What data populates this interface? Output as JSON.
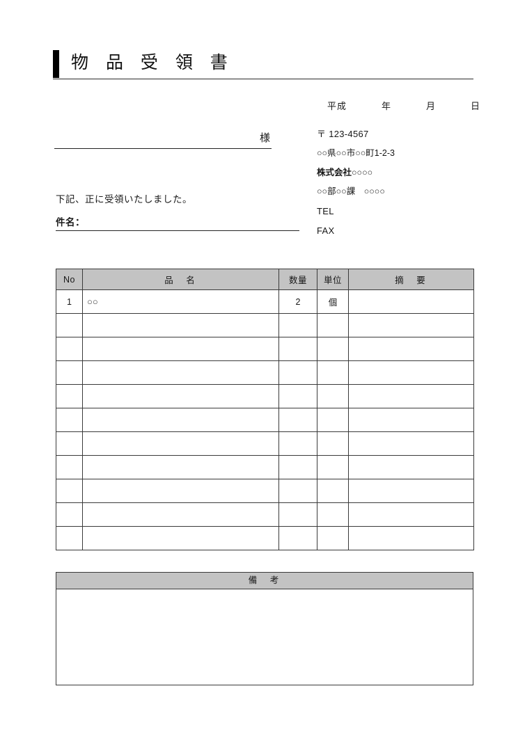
{
  "document": {
    "title": "物 品 受 領 書"
  },
  "date_line": {
    "era": "平成",
    "year": "年",
    "month": "月",
    "day": "日"
  },
  "sender": {
    "postal_code": "〒 123-4567",
    "address": "○○県○○市○○町1-2-3",
    "company": "株式会社○○○○",
    "department": "○○部○○課　○○○○",
    "tel_label": "TEL",
    "fax_label": "FAX"
  },
  "addressee": {
    "honorific": "様"
  },
  "body": {
    "received_note": "下記、正に受領いたしました。",
    "subject_label": "件名："
  },
  "items_table": {
    "headers": {
      "no": "No",
      "name": "品　名",
      "quantity": "数量",
      "unit": "単位",
      "note": "摘　要"
    },
    "rows": [
      {
        "no": "1",
        "name": "○○",
        "quantity": "2",
        "unit": "個",
        "note": ""
      },
      {
        "no": "",
        "name": "",
        "quantity": "",
        "unit": "",
        "note": ""
      },
      {
        "no": "",
        "name": "",
        "quantity": "",
        "unit": "",
        "note": ""
      },
      {
        "no": "",
        "name": "",
        "quantity": "",
        "unit": "",
        "note": ""
      },
      {
        "no": "",
        "name": "",
        "quantity": "",
        "unit": "",
        "note": ""
      },
      {
        "no": "",
        "name": "",
        "quantity": "",
        "unit": "",
        "note": ""
      },
      {
        "no": "",
        "name": "",
        "quantity": "",
        "unit": "",
        "note": ""
      },
      {
        "no": "",
        "name": "",
        "quantity": "",
        "unit": "",
        "note": ""
      },
      {
        "no": "",
        "name": "",
        "quantity": "",
        "unit": "",
        "note": ""
      },
      {
        "no": "",
        "name": "",
        "quantity": "",
        "unit": "",
        "note": ""
      },
      {
        "no": "",
        "name": "",
        "quantity": "",
        "unit": "",
        "note": ""
      }
    ]
  },
  "remarks": {
    "header": "備　考",
    "content": ""
  },
  "colors": {
    "header_gray": "#c3c3c3",
    "border": "#3a3a3a",
    "accent_bar": "#000000",
    "text": "#161616"
  }
}
